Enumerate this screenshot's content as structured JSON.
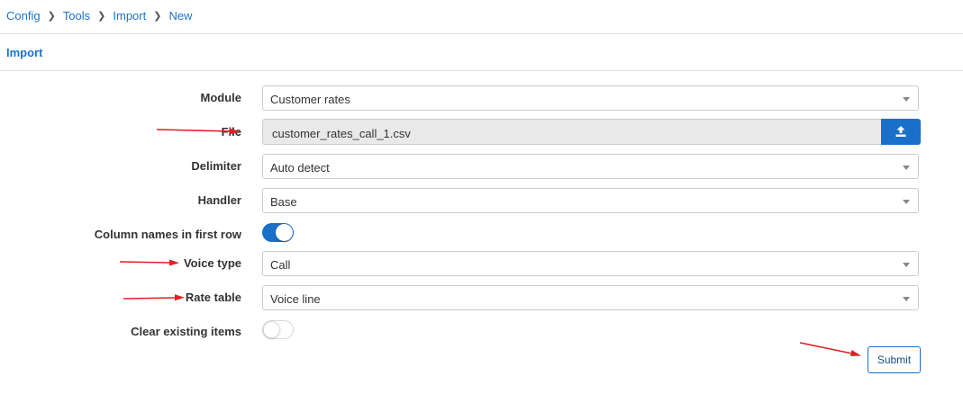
{
  "breadcrumb": [
    "Config",
    "Tools",
    "Import",
    "New"
  ],
  "section_title": "Import",
  "form": {
    "module": {
      "label": "Module",
      "value": "Customer rates"
    },
    "file": {
      "label": "File",
      "value": "customer_rates_call_1.csv"
    },
    "delimiter": {
      "label": "Delimiter",
      "value": "Auto detect"
    },
    "handler": {
      "label": "Handler",
      "value": "Base"
    },
    "column_names": {
      "label": "Column names in first row",
      "enabled": true
    },
    "voice_type": {
      "label": "Voice type",
      "value": "Call"
    },
    "rate_table": {
      "label": "Rate table",
      "value": "Voice line"
    },
    "clear_existing": {
      "label": "Clear existing items",
      "enabled": false
    }
  },
  "submit_label": "Submit",
  "icons": {
    "breadcrumb_separator": "chevron-right-icon",
    "upload": "upload-icon",
    "select_caret": "caret-down-icon"
  },
  "colors": {
    "accent": "#1a6fc9",
    "link": "#1a73c8",
    "annotation_arrow": "#e02020"
  }
}
